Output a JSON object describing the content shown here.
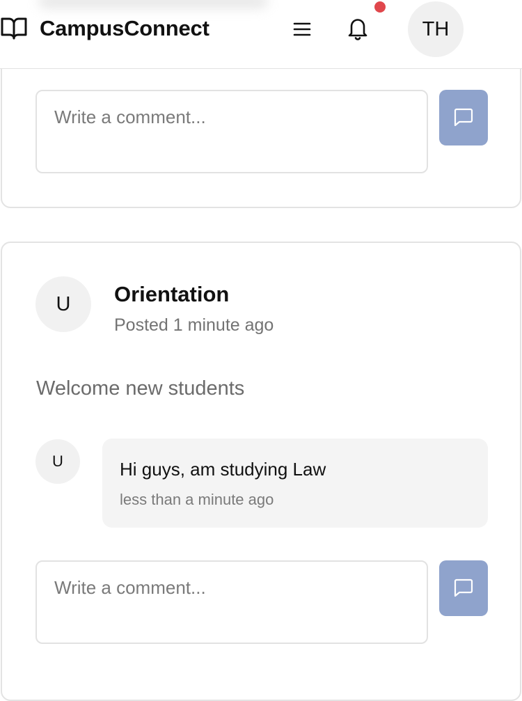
{
  "header": {
    "brand_icon": "open-book-icon",
    "brand_name": "CampusConnect",
    "menu_icon": "hamburger-menu-icon",
    "notification_icon": "bell-icon",
    "notification_dot_color": "#e0474c",
    "user_initials": "TH"
  },
  "first_post": {
    "comment_placeholder": "Write a comment...",
    "send_icon": "message-square-icon"
  },
  "second_post": {
    "author_initial": "U",
    "title": "Orientation",
    "posted": "Posted 1 minute ago",
    "body": "Welcome new students",
    "comments": [
      {
        "author_initial": "U",
        "text": "Hi guys, am studying Law",
        "time": "less than a minute ago"
      }
    ],
    "comment_placeholder": "Write a comment...",
    "send_icon": "message-square-icon"
  },
  "colors": {
    "send_button": "#8fa3cc",
    "card_border": "#e3e3e3",
    "avatar_bg": "#f1f1f1",
    "bubble_bg": "#f4f4f4"
  }
}
